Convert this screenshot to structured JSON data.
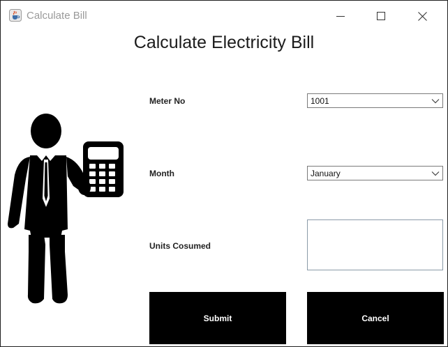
{
  "window": {
    "title": "Calculate Bill",
    "app_icon": "java-cup-icon",
    "controls": [
      "minimize-icon",
      "maximize-icon",
      "close-icon"
    ]
  },
  "form": {
    "heading": "Calculate Electricity Bill",
    "meter_label": "Meter No",
    "meter_value": "1001",
    "month_label": "Month",
    "month_value": "January",
    "units_label": "Units Cosumed",
    "units_value": "",
    "submit_label": "Submit",
    "cancel_label": "Cancel"
  },
  "illustration": {
    "icon": "man-with-calculator-icon"
  },
  "colors": {
    "button_bg": "#000000",
    "button_text": "#ffffff",
    "title_text": "#9a9a9a"
  }
}
